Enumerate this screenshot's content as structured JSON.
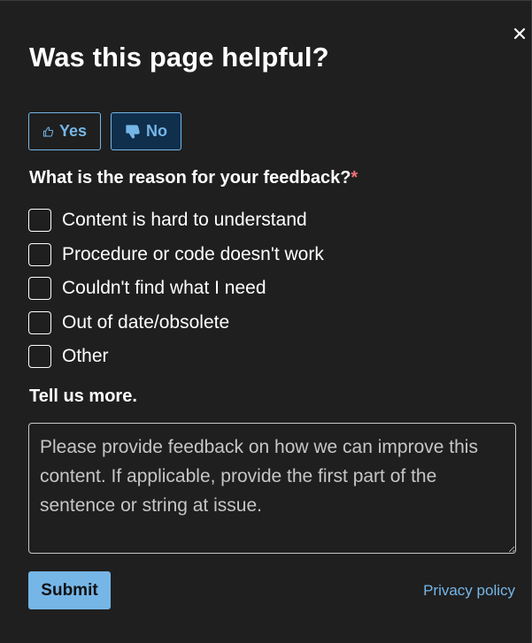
{
  "dialog": {
    "title": "Was this page helpful?",
    "close_icon": "close-icon"
  },
  "vote": {
    "yes_label": "Yes",
    "yes_icon": "thumbs-up-icon",
    "no_label": "No",
    "no_icon": "thumbs-down-icon",
    "selected": "No"
  },
  "reason": {
    "question": "What is the reason for your feedback?",
    "required_marker": "*",
    "options": [
      {
        "label": "Content is hard to understand",
        "checked": false
      },
      {
        "label": "Procedure or code doesn't work",
        "checked": false
      },
      {
        "label": "Couldn't find what I need",
        "checked": false
      },
      {
        "label": "Out of date/obsolete",
        "checked": false
      },
      {
        "label": "Other",
        "checked": false
      }
    ]
  },
  "tell_more": {
    "label": "Tell us more.",
    "placeholder": "Please provide feedback on how we can improve this content. If applicable, provide the first part of the sentence or string at issue.",
    "value": ""
  },
  "footer": {
    "submit_label": "Submit",
    "privacy_label": "Privacy policy"
  },
  "colors": {
    "background": "#1f1f1f",
    "accent": "#75b6e7",
    "selected_bg": "#0f2f4d",
    "required": "#f1707b",
    "text": "#ffffff"
  }
}
